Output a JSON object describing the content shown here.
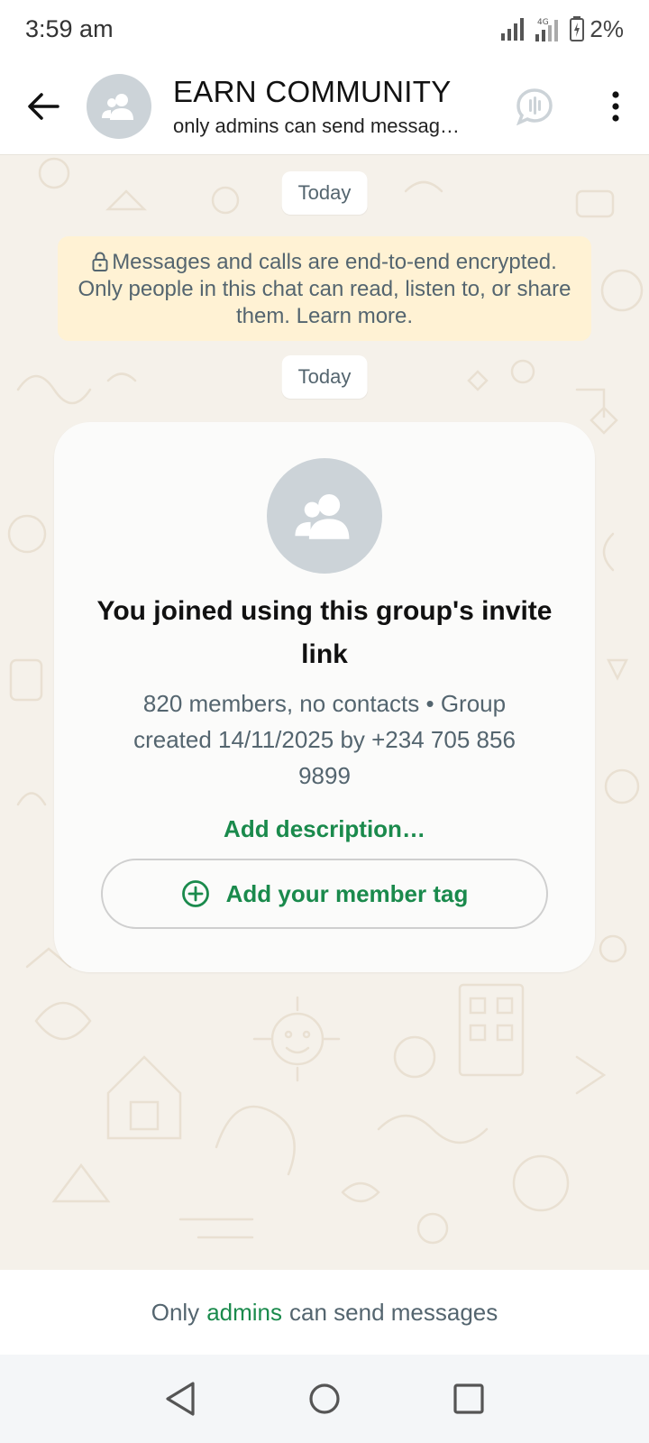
{
  "status_bar": {
    "time": "3:59 am",
    "network": "4G",
    "battery": "2%"
  },
  "header": {
    "title": "EARN COMMUNITY",
    "subtitle": "only admins can send messag…",
    "icons": [
      "back-arrow-icon",
      "group-avatar-icon",
      "voice-chat-icon",
      "more-vert-icon"
    ]
  },
  "chat": {
    "date_chip_1": "Today",
    "encryption_notice": "Messages and calls are end-to-end encrypted. Only people in this chat can read, listen to, or share them. Learn more.",
    "date_chip_2": "Today",
    "group_card": {
      "title": "You joined using this group's invite link",
      "meta": "820 members, no contacts • Group created 14/11/2025 by +234 705 856 9899",
      "add_description": "Add description…",
      "member_tag_button": "Add your member tag"
    }
  },
  "footer": {
    "prefix": "Only",
    "link": "admins",
    "suffix": "can send messages"
  },
  "navigation": {
    "icons": [
      "back-triangle-icon",
      "home-circle-icon",
      "recents-square-icon"
    ]
  },
  "colors": {
    "accent_green": "#1a8a4c",
    "notice_yellow": "#fff2d4",
    "wallpaper": "#f5f1ea",
    "avatar_gray": "#ccd3d8"
  }
}
